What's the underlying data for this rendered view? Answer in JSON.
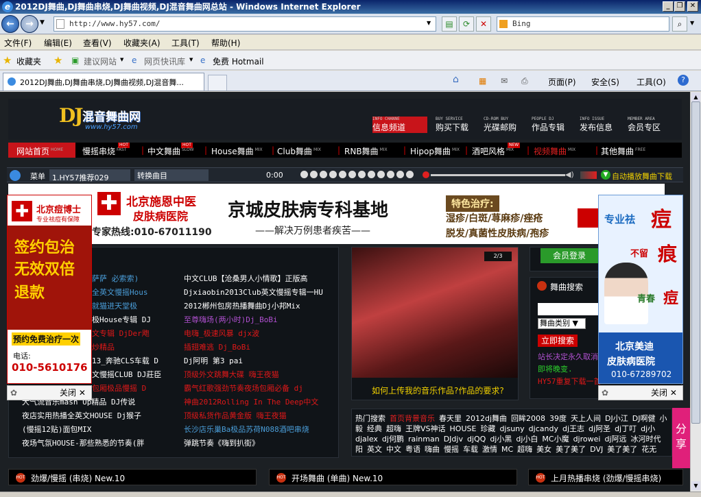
{
  "window": {
    "title": "2012DJ舞曲,DJ舞曲串烧,DJ舞曲视频,DJ混音舞曲网总站 - Windows Internet Explorer"
  },
  "address": {
    "url": "http://www.hy57.com/",
    "search_placeholder": "Bing"
  },
  "menu": [
    "文件(F)",
    "编辑(E)",
    "查看(V)",
    "收藏夹(A)",
    "工具(T)",
    "帮助(H)"
  ],
  "favorites": {
    "label": "收藏夹",
    "items": [
      "建议网站",
      "网页快讯库",
      "免费 Hotmail"
    ]
  },
  "tab": {
    "title": "2012DJ舞曲,DJ舞曲串烧,DJ舞曲视频,DJ混音舞..."
  },
  "commands": {
    "page": "页面(P)",
    "safety": "安全(S)",
    "tools": "工具(O)"
  },
  "site": {
    "logo": {
      "dj": "DJ",
      "name": "混音舞曲网",
      "url": "www.hy57.com"
    },
    "header_nav": [
      {
        "en": "INFO CHANNE",
        "zh": "信息频道"
      },
      {
        "en": "BUY SERVICE",
        "zh": "购买下载"
      },
      {
        "en": "CD-ROM BUY",
        "zh": "光碟邮购"
      },
      {
        "en": "PEOPLE DJ",
        "zh": "作品专辑"
      },
      {
        "en": "INFO ISSUE",
        "zh": "发布信息"
      },
      {
        "en": "MEMBER AREA",
        "zh": "会员专区"
      }
    ],
    "main_menu": [
      {
        "zh": "网站首页",
        "en": "HOME"
      },
      {
        "zh": "慢摇串烧",
        "en": "FAST",
        "badge": "HOT"
      },
      {
        "zh": "中文舞曲",
        "en": "SLOW",
        "badge": "HOT"
      },
      {
        "zh": "House舞曲",
        "en": "MIX"
      },
      {
        "zh": "Club舞曲",
        "en": "MIX"
      },
      {
        "zh": "RNB舞曲",
        "en": "MIX"
      },
      {
        "zh": "Hipop舞曲",
        "en": "MIX"
      },
      {
        "zh": "酒吧风格",
        "en": "MIX",
        "badge": "NEW"
      },
      {
        "zh": "视频舞曲",
        "en": "MIX"
      },
      {
        "zh": "其他舞曲",
        "en": "FREE"
      }
    ],
    "player": {
      "menu": "菜单",
      "track": "1.HY57推荐029",
      "switch": "转换曲目",
      "time": "0:00",
      "autoplay": "自动播放舞曲下载"
    },
    "banner": {
      "hospital": "北京施恩中医",
      "hospital2": "皮肤病医院",
      "hotline": "专家热线:010-67011190",
      "headline": "京城皮肤病专科基地",
      "sub": "——解决万例患者疾苦——",
      "feature": "特色治疗:",
      "f1": "湿疹/白斑/荨麻疹/痤疮",
      "f2": "脱发/真菌性皮肤病/孢疹"
    },
    "ad_left": {
      "brand": "北京痘博士",
      "slogan": "专业祛痘有保障",
      "l1": "签约包治",
      "l2": "无效双倍",
      "l3": "退款",
      "book": "预约免费治疗一次",
      "tel_label": "电话:",
      "tel": "010-5610176",
      "close": "关闭"
    },
    "ad_right": {
      "t1": "专业祛",
      "t2": "痘",
      "t3": "不留",
      "t4": "痕",
      "t5": "青春",
      "t6": "痘",
      "hosp1": "北京美迪",
      "hosp2": "皮肤病医院",
      "tel": "010-67289702",
      "close": "关闭"
    },
    "left_list_a": [
      "萨萨 必索索)",
      "全英文慢摇Hous",
      "就猫进天堂极",
      "极House专辑 DJ",
      "文专辑 DjDer飑",
      "炒精品",
      "13_奔驰CLS车载 D",
      "文慢摇CLUB DJ莊臣",
      "包厢极品慢摇 D",
      "大气流音乐mash Up精品 DJ传说",
      "夜店实用热播全英文HOUSE Dj猴子",
      "(慢摇12贴)面包MIX",
      "夜场气氛HOUSE-那些熟悉的节奏(胖"
    ],
    "left_list_b": [
      "中文CLUB【沧桑男人小情歌】正版高",
      "Djxiaobin2013Club英文慢摇专辑一HU",
      "2012郴州包房热播舞曲Dj小邦Mix",
      "至尊嗨场(两小时)Dj_BoBi",
      "电嗨_极速风暴 djx波",
      "插翅难逃 Dj_BoBi",
      "Dj阿明 第3 pai",
      "顶级外文跳舞大碟 嗨王夜猫",
      "霸气红歌强劲节奏夜场包厢必备 dj",
      "神曲2012Rolling In The Deep中文",
      "顶级私货作品黄金版 嗨王夜猫",
      "长沙店乐巢Ba极品苏荷N088酒吧串烧",
      "弹跳节奏《嗨到扒街》"
    ],
    "photo": {
      "caption": "如何上传我的音乐作品?作品的要求?",
      "pager": "2/3"
    },
    "member": {
      "login": "会员登录"
    },
    "search": {
      "title": "舞曲搜索",
      "category": "舞曲类别",
      "button": "立即搜索",
      "n1": "站长决定永久取消",
      "n2": "即将晚变.",
      "n3": "HY57重复下载一首"
    },
    "tags": {
      "hot_label": "热门搜索",
      "hot_item": "首页背景音乐",
      "words": [
        "春天里",
        "2012dj舞曲",
        "回眸2008",
        "39度",
        "天上人间",
        "DJ小江",
        "DJ啊健",
        "小毅",
        "经典",
        "超嗨",
        "王牌VS神话",
        "HOUSE",
        "珍藏",
        "djsuny",
        "djcandy",
        "dj王志",
        "dj阿圣",
        "dj丁叮",
        "dj小",
        "djalex",
        "dj何鹏",
        "rainman",
        "DJdjv",
        "djQQ",
        "dj小黑",
        "dj小白",
        "MC小魔",
        "djrowei",
        "dj阿远",
        "冰河时代",
        "阳",
        "英文",
        "中文",
        "粤语",
        "嗨曲",
        "慢摇",
        "车载",
        "激情",
        "MC",
        "超嗨",
        "美女",
        "美了美了",
        "DVJ",
        "美了美了",
        "花无"
      ]
    },
    "sections": [
      "劲爆/慢摇 (串烧) New.10",
      "开场舞曲 (单曲) New.10",
      "上月热播串烧 (劲爆/慢摇串烧)"
    ],
    "share": "分享"
  }
}
